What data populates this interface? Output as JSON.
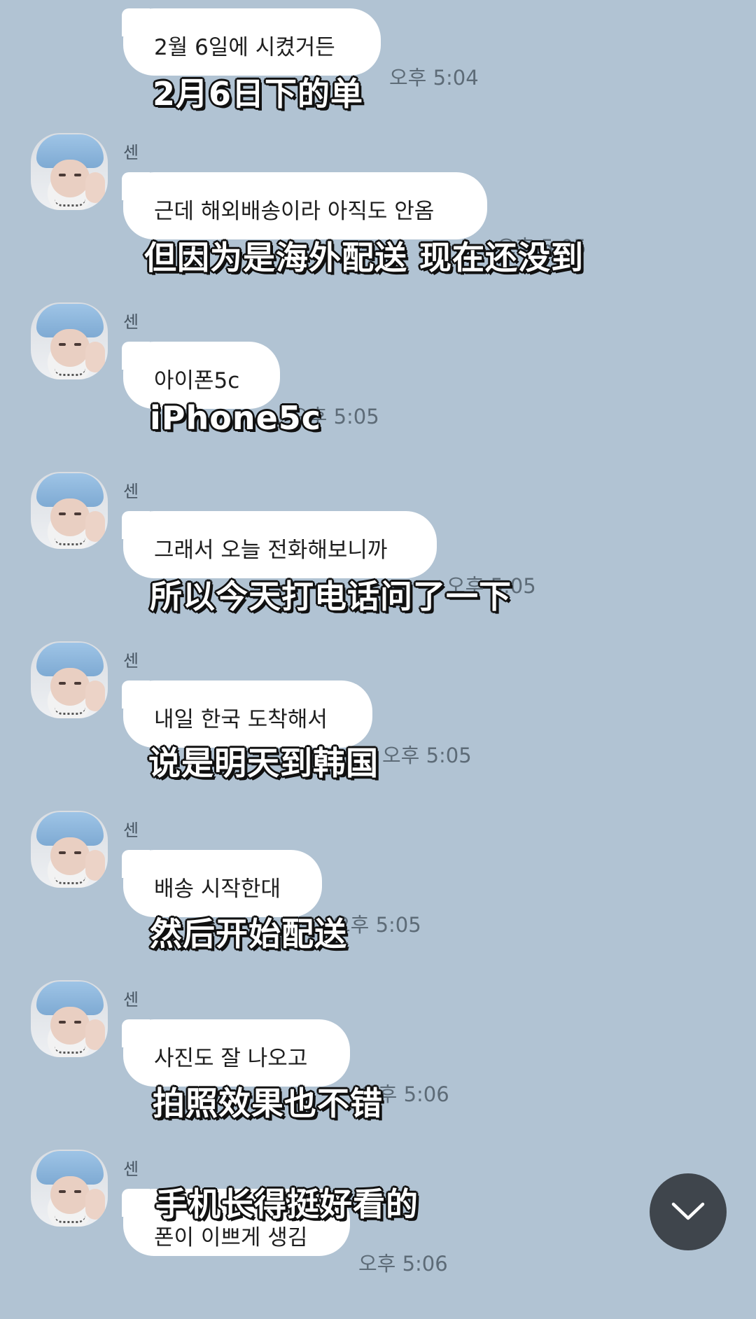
{
  "messages": [
    {
      "sender": "",
      "text": "2월 6일에 시켰거든",
      "time": "오후 5:04",
      "subtitle": "2月6日下的单"
    },
    {
      "sender": "센",
      "text": "근데 해외배송이라 아직도 안옴",
      "time": "오후 5:05",
      "subtitle": "但因为是海外配送 现在还没到"
    },
    {
      "sender": "센",
      "text": "아이폰5c",
      "time": "오후 5:05",
      "subtitle": "iPhone5c"
    },
    {
      "sender": "센",
      "text": "그래서 오늘 전화해보니까",
      "time": "오후 5:05",
      "subtitle": "所以今天打电话问了一下"
    },
    {
      "sender": "센",
      "text": "내일 한국 도착해서",
      "time": "오후 5:05",
      "subtitle": "说是明天到韩国"
    },
    {
      "sender": "센",
      "text": "배송 시작한대",
      "time": "오후 5:05",
      "subtitle": "然后开始配送"
    },
    {
      "sender": "센",
      "text": "사진도 잘 나오고",
      "time": "오후 5:06",
      "subtitle": "拍照效果也不错"
    },
    {
      "sender": "센",
      "text": "폰이 이쁘게 생김",
      "time": "오후 5:06",
      "subtitle": "手机长得挺好看的"
    }
  ],
  "scroll_button": {
    "icon": "chevron-down-icon"
  },
  "colors": {
    "background": "#b1c3d3",
    "bubble": "#ffffff",
    "scroll_button": "#3f454c"
  }
}
